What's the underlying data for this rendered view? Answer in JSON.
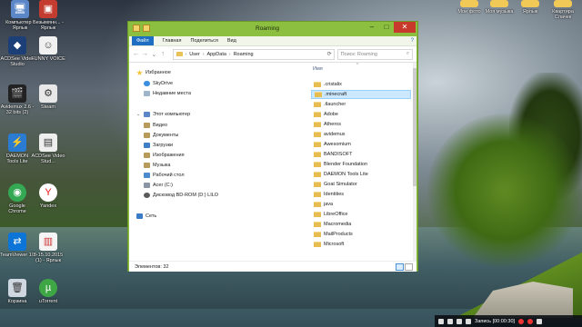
{
  "desktop": {
    "left_icons": [
      {
        "label": "Компьютер - Ярлык",
        "icon": "computer-icon"
      },
      {
        "label": "Безымянн... - Ярлык",
        "icon": "red-folder-icon"
      },
      {
        "label": "ACDSee Video Studio",
        "icon": "acdsee-icon"
      },
      {
        "label": "FUNNY VOICE",
        "icon": "funny-voice-icon"
      },
      {
        "label": "Avidemux 2.6 - 32 bits (2)",
        "icon": "avidemux-icon"
      },
      {
        "label": "Steam",
        "icon": "steam-icon"
      },
      {
        "label": "DAEMON Tools Lite",
        "icon": "daemon-tools-icon"
      },
      {
        "label": "ACDSee Video Stud...",
        "icon": "acdsee-icon"
      },
      {
        "label": "Google Chrome",
        "icon": "chrome-icon"
      },
      {
        "label": "Yandex",
        "icon": "yandex-icon"
      },
      {
        "label": "TeamViewer 10",
        "icon": "teamviewer-icon"
      },
      {
        "label": "8-15.10.2015 (1) - Ярлык",
        "icon": "document-icon"
      },
      {
        "label": "Корзина",
        "icon": "recycle-bin-icon"
      },
      {
        "label": "uTorrent",
        "icon": "utorrent-icon"
      }
    ],
    "right_icons": [
      {
        "label": "Мои фото",
        "icon": "folder-icon"
      },
      {
        "label": "Моя музыка",
        "icon": "folder-icon"
      },
      {
        "label": "Ярлык",
        "icon": "folder-icon"
      },
      {
        "label": "Квартира Слачек",
        "icon": "folder-icon"
      }
    ]
  },
  "window": {
    "title": "Roaming",
    "ribbon_tabs": [
      "Файл",
      "Главная",
      "Поделиться",
      "Вид"
    ],
    "address": {
      "parts": [
        "User",
        "AppData",
        "Roaming"
      ]
    },
    "search_placeholder": "Поиск: Roaming",
    "column_header": "Имя",
    "nav": {
      "favorites": "Избранное",
      "favorites_items": [
        "SkyDrive",
        "Недавние места"
      ],
      "this_pc": "Этот компьютер",
      "pc_items": [
        "Видео",
        "Документы",
        "Загрузки",
        "Изображения",
        "Музыка",
        "Рабочий стол",
        "Acer (C:)",
        "Дисковод BD-ROM (D:) LILO"
      ],
      "network": "Сеть"
    },
    "files": [
      ".cristalix",
      ".minecraft",
      ".tlauncher",
      "Adobe",
      "Atheros",
      "avidemux",
      "Awesomium",
      "BANDISOFT",
      "Blender Foundation",
      "DAEMON Tools Lite",
      "Goat Simulator",
      "Identities",
      "java",
      "LibreOffice",
      "Macromedia",
      "MailProducts",
      "Microsoft"
    ],
    "selected_file": ".minecraft",
    "status_text": "Элементов: 32"
  },
  "tray": {
    "record_label": "Запись [00:00:30]"
  },
  "colors": {
    "window_frame": "#8cbf3f",
    "file_tab": "#1e6fc4",
    "selection": "#cce8ff",
    "close_button": "#c7392b"
  }
}
